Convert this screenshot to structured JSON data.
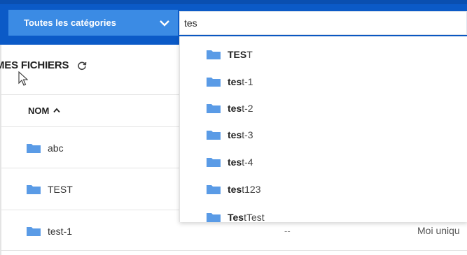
{
  "header": {
    "category_label": "Toutes les catégories",
    "search_value": "tes"
  },
  "main": {
    "section_title": "MES FICHIERS",
    "column_name": "NOM",
    "rows": [
      {
        "name": "abc"
      },
      {
        "name": "TEST"
      },
      {
        "name": "test-1",
        "size": "--",
        "owner": "Moi uniqu"
      }
    ]
  },
  "suggestions": [
    {
      "match": "TES",
      "rest": "T"
    },
    {
      "match": "tes",
      "rest": "t-1"
    },
    {
      "match": "tes",
      "rest": "t-2"
    },
    {
      "match": "tes",
      "rest": "t-3"
    },
    {
      "match": "tes",
      "rest": "t-4"
    },
    {
      "match": "tes",
      "rest": "t123"
    },
    {
      "match": "Tes",
      "rest": "tTest"
    }
  ],
  "colors": {
    "topbar": "#0b5ac7",
    "select": "#3b8be4",
    "folder": "#5a9be6"
  },
  "icons": {
    "chevron": "chevron-down-icon",
    "refresh": "refresh-icon",
    "sort": "sort-asc-icon",
    "folder": "folder-icon",
    "cursor": "mouse-pointer-icon"
  }
}
